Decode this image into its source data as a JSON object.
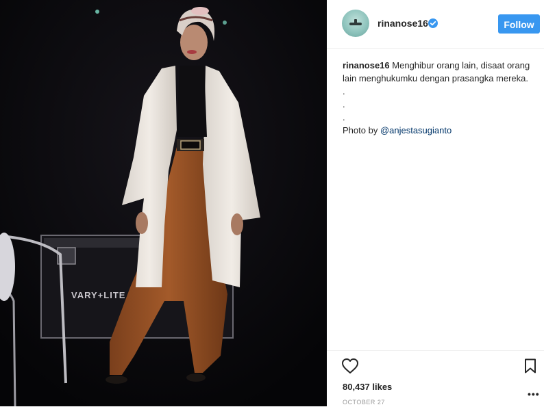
{
  "post": {
    "username": "rinanose16",
    "follow_label": "Follow",
    "caption_user": "rinanose16",
    "caption_text": "Menghibur orang lain, disaat orang lain menghukumku dengan prasangka mereka.",
    "caption_dots": [
      ".",
      ".",
      "."
    ],
    "photo_credit_prefix": "Photo by ",
    "photo_credit_mention": "@anjestasugianto",
    "likes": "80,437 likes",
    "date": "OCTOBER 27",
    "more_label": "•••"
  },
  "photo": {
    "case_label": "VARY+LITE"
  },
  "icons": {
    "verified": "verified-badge-icon",
    "heart": "heart-outline-icon",
    "bookmark": "bookmark-outline-icon",
    "more": "more-options-icon"
  },
  "colors": {
    "follow_bg": "#3897f0",
    "verified": "#3897f0",
    "mention": "#003569",
    "date": "#999999"
  }
}
